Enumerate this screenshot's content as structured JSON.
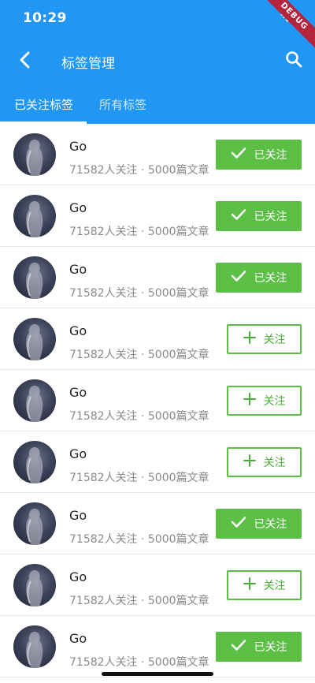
{
  "status_bar": {
    "time": "10:29",
    "debug_label": "DEBUG"
  },
  "toolbar": {
    "title": "标签管理"
  },
  "tabs": [
    {
      "label": "已关注标签",
      "active": true
    },
    {
      "label": "所有标签",
      "active": false
    }
  ],
  "colors": {
    "appbar": "#2196f3",
    "followed_button": "#5bbf45",
    "debug_ribbon": "#b3263b"
  },
  "tags": [
    {
      "name": "Go",
      "meta": "71582人关注 · 5000篇文章",
      "followed": true,
      "button_label": "已关注"
    },
    {
      "name": "Go",
      "meta": "71582人关注 · 5000篇文章",
      "followed": true,
      "button_label": "已关注"
    },
    {
      "name": "Go",
      "meta": "71582人关注 · 5000篇文章",
      "followed": true,
      "button_label": "已关注"
    },
    {
      "name": "Go",
      "meta": "71582人关注 · 5000篇文章",
      "followed": false,
      "button_label": "关注"
    },
    {
      "name": "Go",
      "meta": "71582人关注 · 5000篇文章",
      "followed": false,
      "button_label": "关注"
    },
    {
      "name": "Go",
      "meta": "71582人关注 · 5000篇文章",
      "followed": false,
      "button_label": "关注"
    },
    {
      "name": "Go",
      "meta": "71582人关注 · 5000篇文章",
      "followed": true,
      "button_label": "已关注"
    },
    {
      "name": "Go",
      "meta": "71582人关注 · 5000篇文章",
      "followed": false,
      "button_label": "关注"
    },
    {
      "name": "Go",
      "meta": "71582人关注 · 5000篇文章",
      "followed": true,
      "button_label": "已关注"
    }
  ]
}
